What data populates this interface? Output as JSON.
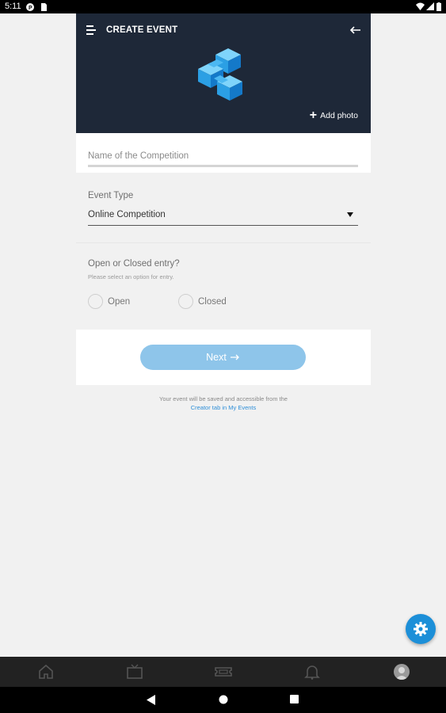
{
  "status_bar": {
    "time": "5:11"
  },
  "header": {
    "title": "CREATE EVENT",
    "add_photo": "Add photo"
  },
  "name_field": {
    "placeholder": "Name of the Competition",
    "value": ""
  },
  "event_type": {
    "label": "Event Type",
    "selected": "Online Competition"
  },
  "entry": {
    "label": "Open or Closed entry?",
    "hint": "Please select an option for entry.",
    "options": [
      "Open",
      "Closed"
    ]
  },
  "next_button": {
    "label": "Next"
  },
  "footer_note": {
    "text": "Your event will be saved and accessible from the",
    "link": "Creator tab in My Events"
  },
  "colors": {
    "header_bg": "#1e2838",
    "accent": "#1c8fd8",
    "next_button_bg": "#8ec5ea",
    "bottom_nav_bg": "#222222"
  },
  "icons": [
    "menu-icon",
    "back-arrow-icon",
    "app-logo",
    "plus-icon",
    "gear-icon",
    "home-icon",
    "tv-icon",
    "ticket-icon",
    "bell-icon",
    "avatar",
    "back-triangle-icon",
    "home-circle-icon",
    "recents-square-icon"
  ]
}
